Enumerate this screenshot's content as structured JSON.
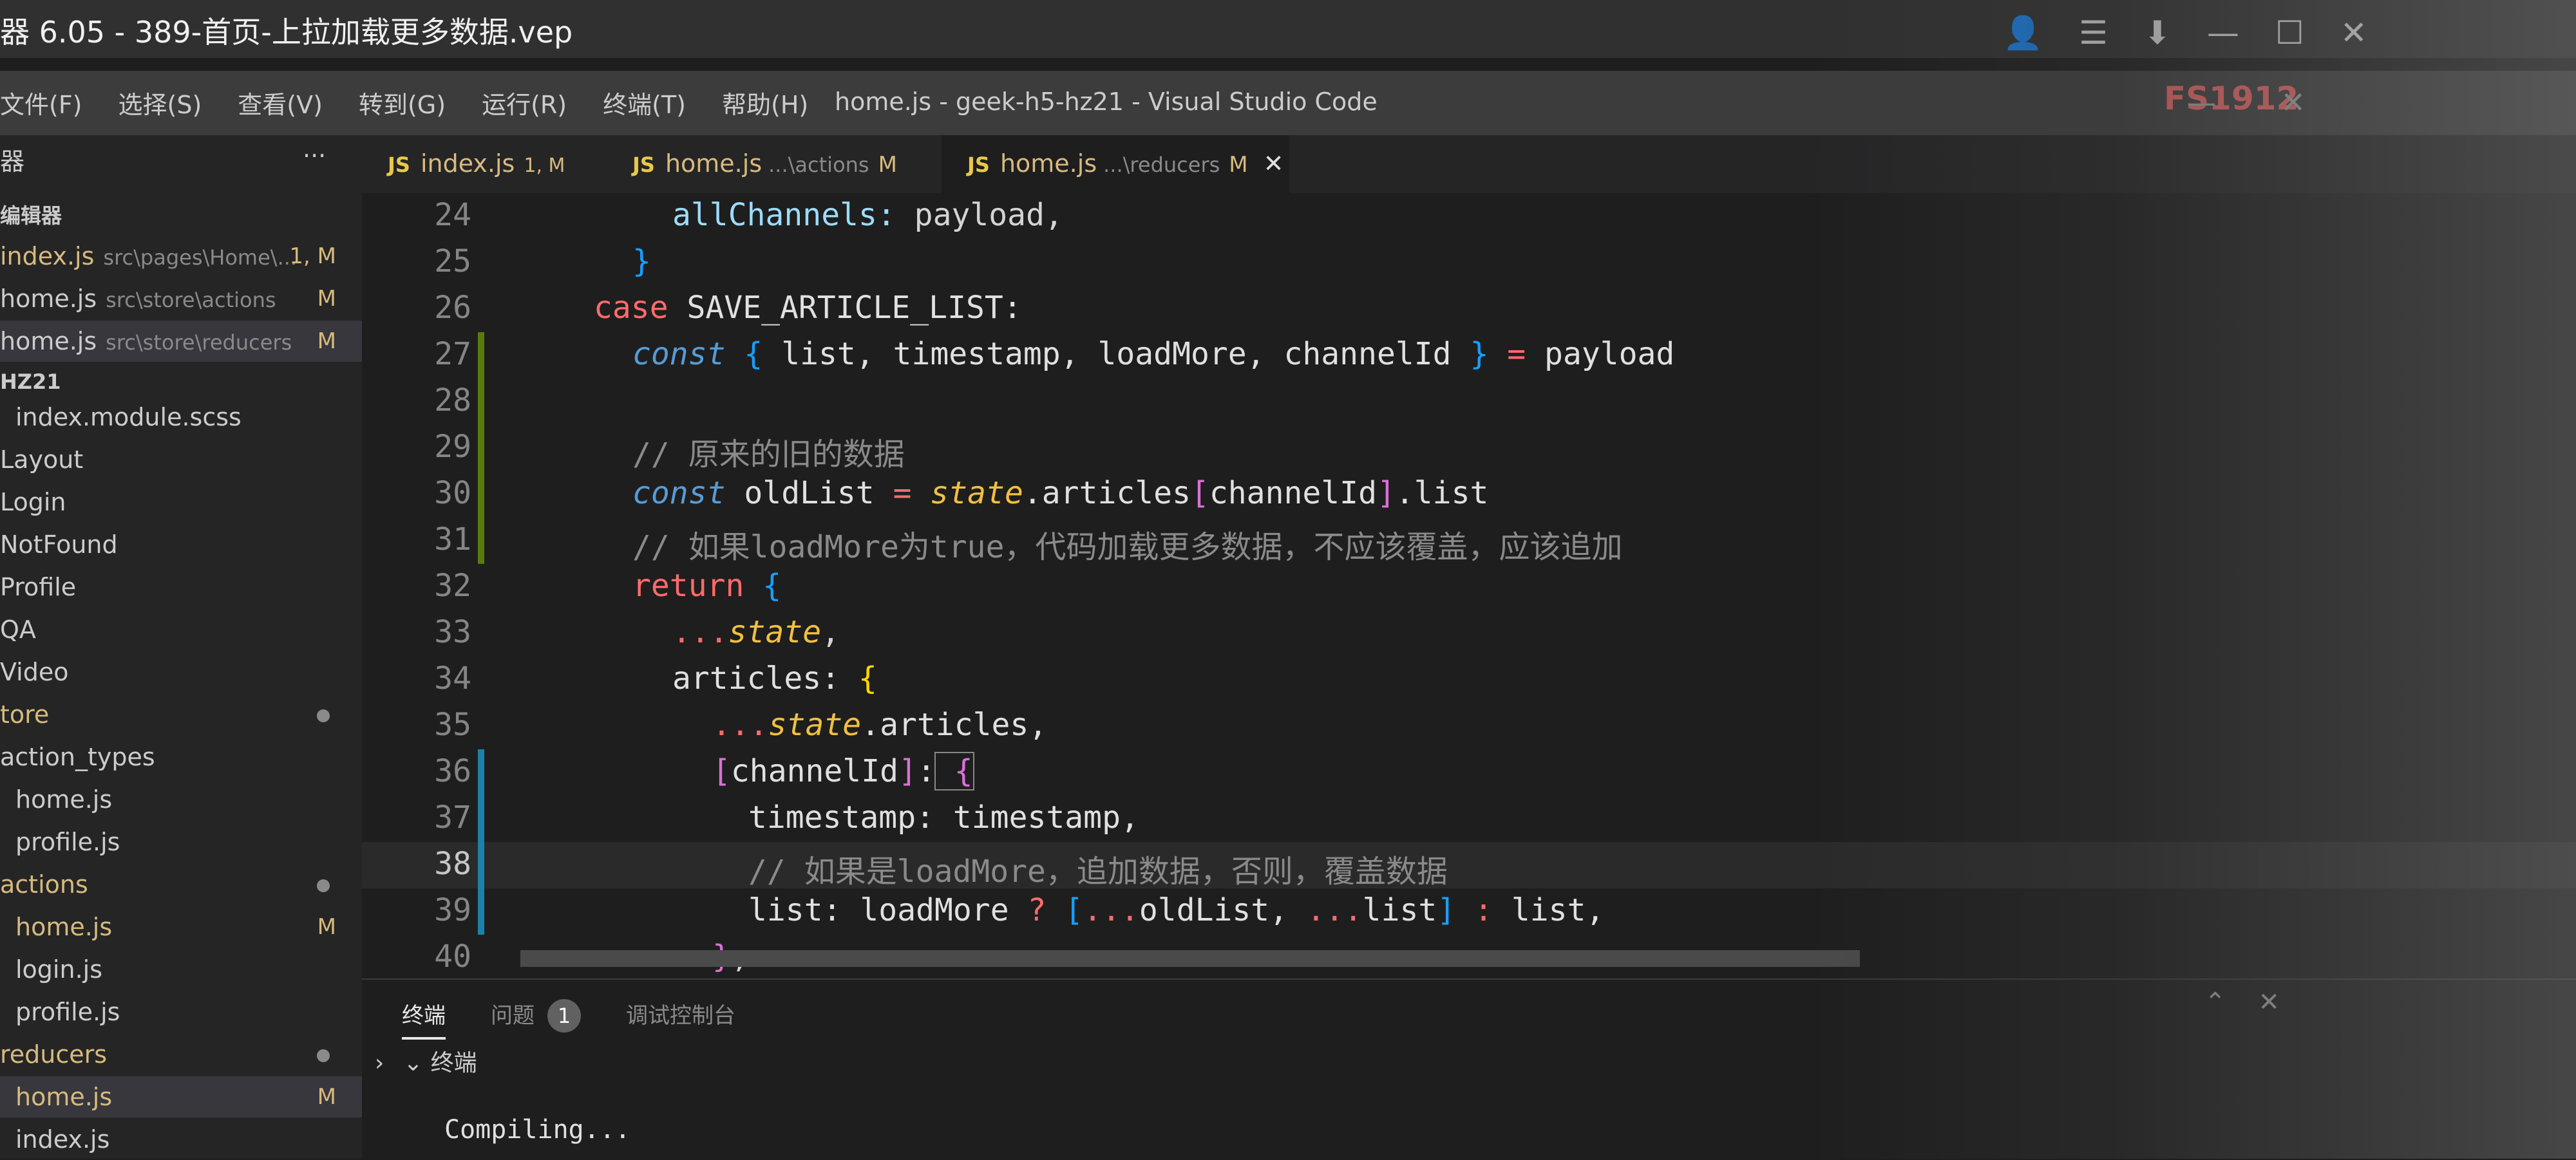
{
  "player": {
    "title": "器 6.05 - 389-首页-上拉加载更多数据.vep"
  },
  "menu": [
    "文件(F)",
    "选择(S)",
    "查看(V)",
    "转到(G)",
    "运行(R)",
    "终端(T)",
    "帮助(H)"
  ],
  "window_title": "home.js - geek-h5-hz21 - Visual Studio Code",
  "overlay_text": "FS1912",
  "sidebar": {
    "explorer_label": "器",
    "section_open": "编辑器",
    "more_glyph": "···",
    "open_editors": [
      {
        "name": "index.js",
        "path": "src\\pages\\Home\\...",
        "badge": "1, M"
      },
      {
        "name": "home.js",
        "path": "src\\store\\actions",
        "badge": "M"
      },
      {
        "name": "home.js",
        "path": "src\\store\\reducers",
        "badge": "M"
      }
    ],
    "project": "HZ21",
    "tree": [
      {
        "label": "index.module.scss"
      },
      {
        "label": "Layout"
      },
      {
        "label": "Login"
      },
      {
        "label": "NotFound"
      },
      {
        "label": "Profile"
      },
      {
        "label": "QA"
      },
      {
        "label": "Video"
      },
      {
        "label": "tore"
      },
      {
        "label": "action_types"
      },
      {
        "label": "home.js"
      },
      {
        "label": "profile.js"
      },
      {
        "label": "actions"
      },
      {
        "label": "home.js",
        "badge": "M"
      },
      {
        "label": "login.js"
      },
      {
        "label": "profile.js"
      },
      {
        "label": "reducers"
      },
      {
        "label": "home.js",
        "badge": "M"
      },
      {
        "label": "index.js"
      }
    ]
  },
  "tabs": [
    {
      "icon": "JS",
      "name": "index.js",
      "path": "",
      "badge": "1, M"
    },
    {
      "icon": "JS",
      "name": "home.js",
      "path": "...\\actions",
      "badge": "M"
    },
    {
      "icon": "JS",
      "name": "home.js",
      "path": "...\\reducers",
      "badge": "M",
      "close": "✕"
    }
  ],
  "editor": {
    "line_numbers": [
      "24",
      "25",
      "26",
      "27",
      "28",
      "29",
      "30",
      "31",
      "32",
      "33",
      "34",
      "35",
      "36",
      "37",
      "38",
      "39",
      "40"
    ],
    "code": {
      "l24": [
        "allChannels:",
        " payload,"
      ],
      "l25": "}",
      "l26": [
        "case",
        " SAVE_ARTICLE_LIST:"
      ],
      "l27": [
        "const",
        " {",
        " list, timestamp, loadMore, channelId",
        " }",
        " =",
        " payload"
      ],
      "l29": "// 原来的旧的数据",
      "l30": [
        "const",
        " oldList",
        " =",
        " state",
        ".articles",
        "[",
        "channelId",
        "]",
        ".list"
      ],
      "l31": "// 如果loadMore为true，代码加载更多数据，不应该覆盖，应该追加",
      "l32": [
        "return",
        " {"
      ],
      "l33": [
        "...",
        "state",
        ","
      ],
      "l34": [
        "articles:",
        " {"
      ],
      "l35": [
        "...",
        "state",
        ".articles,"
      ],
      "l36": [
        "[",
        "channelId",
        "]",
        ":",
        " {"
      ],
      "l37": "timestamp: timestamp,",
      "l38": "// 如果是loadMore，追加数据，否则，覆盖数据",
      "l39": [
        "list:",
        " loadMore",
        " ?",
        " [",
        "...",
        "oldList,",
        " ...",
        "list",
        "]",
        " :",
        " list,"
      ],
      "l40": [
        "}",
        ","
      ]
    }
  },
  "panel": {
    "tabs": [
      "终端",
      "问题",
      "调试控制台"
    ],
    "problems_count": "1",
    "terminal_label": "终端",
    "output": "Compiling..."
  },
  "colors": {
    "background": "#1e1e1e",
    "sidebar": "#252526",
    "titlebar": "#3c3c3c",
    "keyword": "#c586c0",
    "comment": "#6a9955"
  }
}
